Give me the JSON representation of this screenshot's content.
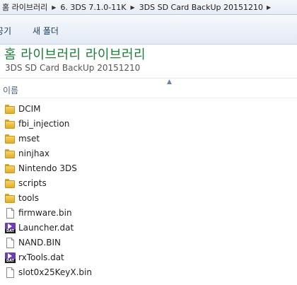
{
  "address": {
    "crumbs": [
      "홈 라이브러리",
      "6. 3DS 7.1.0-11K",
      "3DS SD Card BackUp 20151210"
    ]
  },
  "command_bar": {
    "share_label": "공기",
    "new_folder_label": "새 폴더"
  },
  "library": {
    "title": "홈 라이브러리 라이브러리",
    "subtitle": "3DS SD Card BackUp 20151210"
  },
  "columns": {
    "name_label": "이름"
  },
  "files": [
    {
      "name": "DCIM",
      "icon": "folder-icon"
    },
    {
      "name": "fbi_injection",
      "icon": "folder-icon"
    },
    {
      "name": "mset",
      "icon": "folder-icon"
    },
    {
      "name": "ninjhax",
      "icon": "folder-icon"
    },
    {
      "name": "Nintendo 3DS",
      "icon": "folder-icon"
    },
    {
      "name": "scripts",
      "icon": "folder-icon"
    },
    {
      "name": "tools",
      "icon": "folder-icon"
    },
    {
      "name": "firmware.bin",
      "icon": "file-icon"
    },
    {
      "name": "Launcher.dat",
      "icon": "dat-file-icon",
      "badge": "DAT"
    },
    {
      "name": "NAND.BIN",
      "icon": "file-icon"
    },
    {
      "name": "rxTools.dat",
      "icon": "dat-file-icon",
      "badge": "DAT"
    },
    {
      "name": "slot0x25KeyX.bin",
      "icon": "file-icon"
    }
  ],
  "colors": {
    "library_title": "#1e7d3a",
    "folder": "#f0c445",
    "dat_icon": "#6a3fb5"
  }
}
